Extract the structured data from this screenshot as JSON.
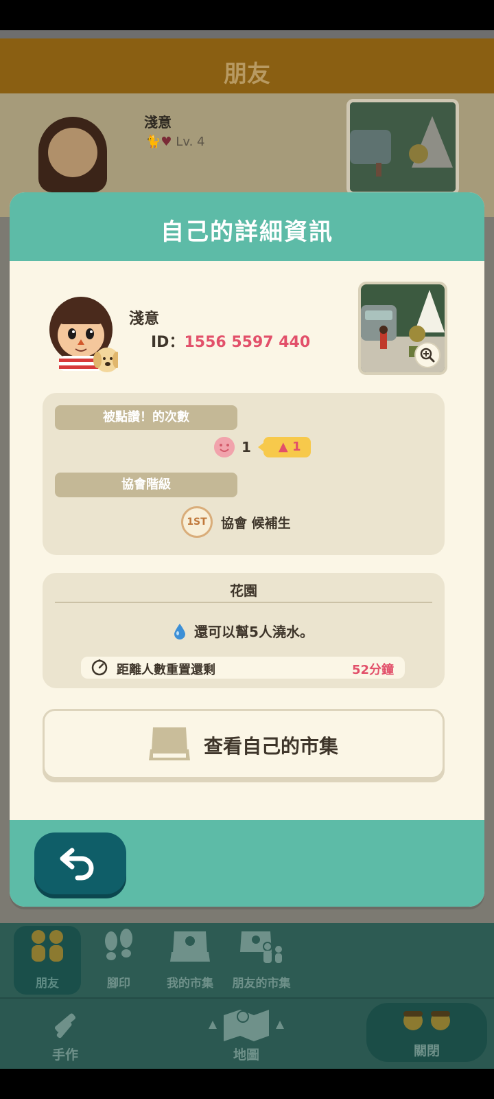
{
  "background": {
    "header_title": "朋友",
    "friend_name": "淺意",
    "friend_level": "Lv. 4"
  },
  "modal": {
    "title": "自己的詳細資訊",
    "name": "淺意",
    "id_label": "ID：",
    "id_value": "1556 5597 440",
    "likes_label": "被點讚！的次數",
    "likes_count": "1",
    "likes_delta": "1",
    "rank_label": "協會階級",
    "rank_value": "協會 候補生",
    "rank_icon_text": "1ST",
    "garden": {
      "title": "花園",
      "water_text": "還可以幫5人澆水。",
      "reset_label": "距離人數重置還剩",
      "reset_time": "52分鐘"
    },
    "market_button": "查看自己的市集"
  },
  "tabs": [
    {
      "label": "朋友",
      "icon": "friends-icon",
      "active": true
    },
    {
      "label": "腳印",
      "icon": "footprints-icon",
      "active": false
    },
    {
      "label": "我的市集",
      "icon": "market-icon",
      "active": false
    },
    {
      "label": "朋友的市集",
      "icon": "friends-market-icon",
      "active": false
    }
  ],
  "nav": {
    "craft": "手作",
    "map": "地圖",
    "close": "關閉"
  },
  "colors": {
    "teal": "#5dbba7",
    "dark_teal": "#0f5e68",
    "accent_pink": "#e2506a",
    "cream": "#fbf6e6",
    "tan": "#c4b896"
  }
}
